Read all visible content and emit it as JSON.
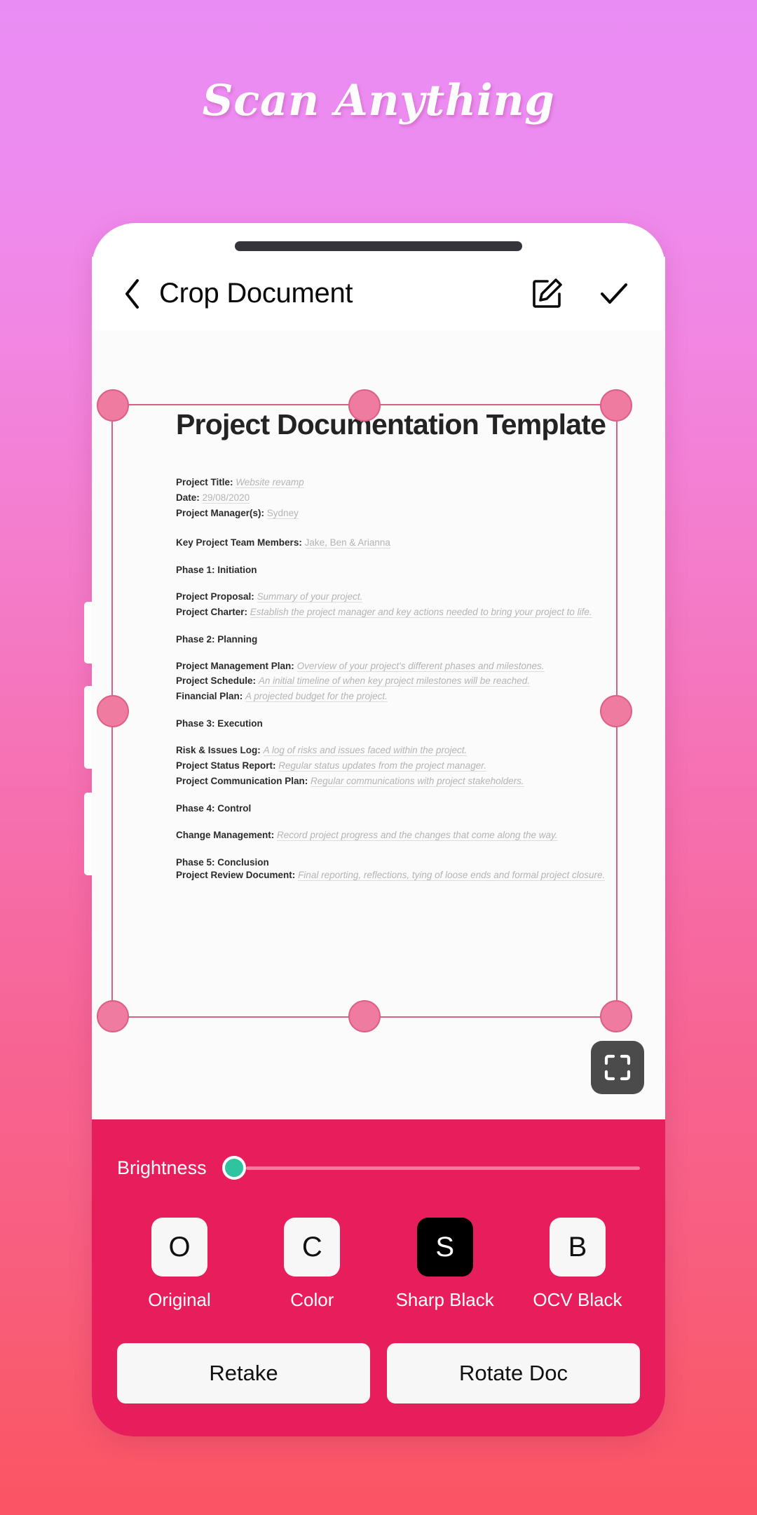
{
  "hero": {
    "title": "Scan Anything"
  },
  "theme": {
    "gradient_top": "#E98DF4",
    "gradient_bottom": "#FB5463",
    "panel_pink": "#E81E5C",
    "handle_pink": "#EF7BA0",
    "crop_line": "#DC5F85",
    "slider_thumb": "#2FC4A0",
    "selected_chip": "#000000"
  },
  "appbar": {
    "back_icon": "chevron-left-icon",
    "title": "Crop Document",
    "edit_icon": "edit-square-icon",
    "done_icon": "check-icon"
  },
  "preview": {
    "fullscreen_icon": "fullscreen-expand-icon",
    "handles": [
      "top-left",
      "top-center",
      "top-right",
      "middle-left",
      "middle-right",
      "bottom-left",
      "bottom-center",
      "bottom-right"
    ]
  },
  "document": {
    "heading": "Project Documentation Template",
    "meta": [
      {
        "label": "Project Title:",
        "value": "Website revamp",
        "italic": true
      },
      {
        "label": "Date:",
        "value": "29/08/2020",
        "italic": false
      },
      {
        "label": "Project Manager(s):",
        "value": "Sydney",
        "italic": false
      }
    ],
    "team": {
      "label": "Key Project Team Members:",
      "value": "Jake, Ben & Arianna"
    },
    "sections": [
      {
        "phase": "Phase 1: Initiation",
        "items": [
          {
            "label": "Project Proposal:",
            "value": "Summary of your project."
          },
          {
            "label": "Project Charter:",
            "value": "Establish the project manager and key actions needed to bring your project to life."
          }
        ]
      },
      {
        "phase": "Phase 2: Planning",
        "items": [
          {
            "label": "Project Management Plan:",
            "value": "Overview of your project's different phases and milestones."
          },
          {
            "label": "Project Schedule:",
            "value": "An initial timeline of when key project milestones will be reached."
          },
          {
            "label": "Financial Plan:",
            "value": "A projected budget for the project."
          }
        ]
      },
      {
        "phase": "Phase 3: Execution",
        "items": [
          {
            "label": "Risk & Issues Log:",
            "value": "A log of risks and issues faced within the project."
          },
          {
            "label": "Project Status Report:",
            "value": "Regular status updates from the project manager."
          },
          {
            "label": "Project Communication Plan:",
            "value": "Regular communications with project stakeholders."
          }
        ]
      },
      {
        "phase": "Phase 4: Control",
        "items": [
          {
            "label": "Change Management:",
            "value": "Record project progress and the changes that come along the way."
          }
        ]
      },
      {
        "phase": "Phase 5: Conclusion",
        "items": [
          {
            "label": "Project Review Document:",
            "value": "Final reporting, reflections, tying of loose ends and formal project closure."
          }
        ]
      }
    ]
  },
  "panel": {
    "brightness": {
      "label": "Brightness",
      "value": 0
    },
    "filters": [
      {
        "glyph": "O",
        "label": "Original",
        "selected": false
      },
      {
        "glyph": "C",
        "label": "Color",
        "selected": false
      },
      {
        "glyph": "S",
        "label": "Sharp Black",
        "selected": true
      },
      {
        "glyph": "B",
        "label": "OCV Black",
        "selected": false
      }
    ],
    "actions": [
      {
        "label": "Retake"
      },
      {
        "label": "Rotate Doc"
      }
    ]
  }
}
